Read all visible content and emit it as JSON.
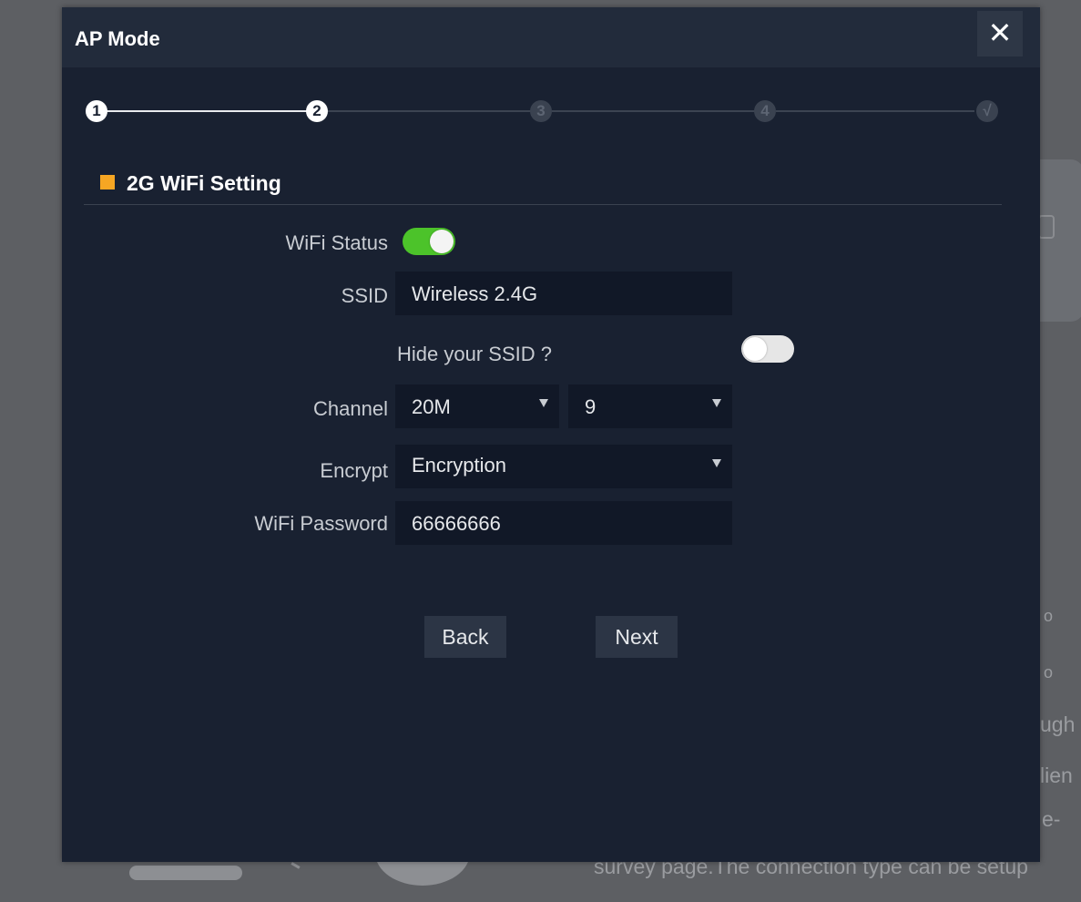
{
  "background": {
    "text_lines": [
      "o",
      "o",
      "ugh",
      "lien",
      "e-",
      "survey page.The connection type can be setup"
    ]
  },
  "dialog": {
    "title": "AP Mode",
    "close_label": "✕"
  },
  "stepper": {
    "steps": [
      "1",
      "2",
      "3",
      "4",
      "√"
    ],
    "current_step": 2
  },
  "section": {
    "title": "2G WiFi Setting",
    "accent_color": "#f6a623"
  },
  "form": {
    "wifi_status_label": "WiFi Status",
    "wifi_status_on": true,
    "ssid_label": "SSID",
    "ssid_value": "Wireless 2.4G",
    "hide_ssid_label": "Hide your SSID ?",
    "hide_ssid_on": false,
    "channel_label": "Channel",
    "channel_width_value": "20M",
    "channel_number_value": "9",
    "encrypt_label": "Encrypt",
    "encrypt_value": "Encryption",
    "password_label": "WiFi Password",
    "password_value": "66666666"
  },
  "buttons": {
    "back": "Back",
    "next": "Next"
  },
  "colors": {
    "toggle_on": "#4cc32a",
    "modal_bg": "#192131"
  }
}
